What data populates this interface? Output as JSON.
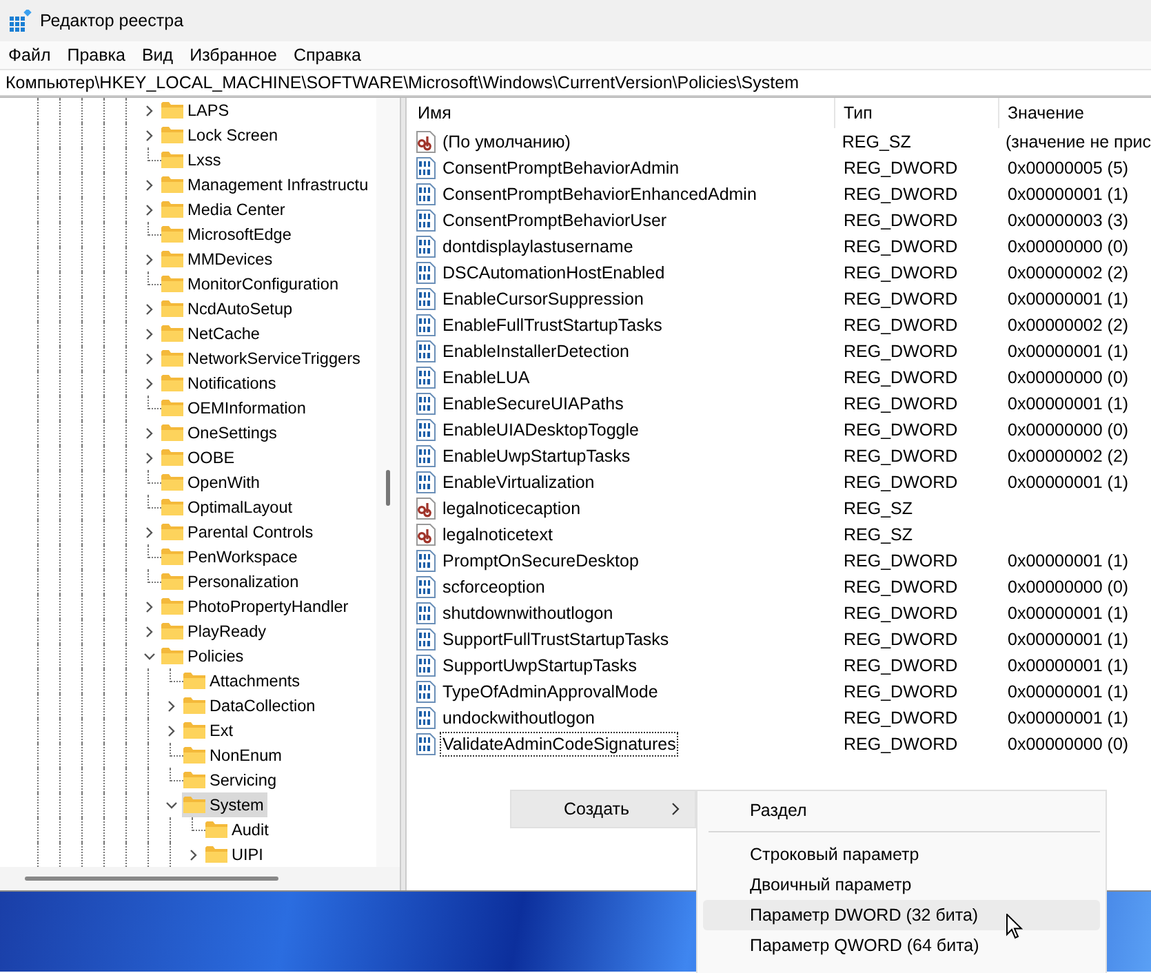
{
  "window": {
    "title": "Редактор реестра"
  },
  "menu_bar": [
    "Файл",
    "Правка",
    "Вид",
    "Избранное",
    "Справка"
  ],
  "address_bar": {
    "value": "Компьютер\\HKEY_LOCAL_MACHINE\\SOFTWARE\\Microsoft\\Windows\\CurrentVersion\\Policies\\System"
  },
  "tree": {
    "items": [
      {
        "label": "LAPS",
        "expandable": true,
        "expanded": false,
        "selected": false
      },
      {
        "label": "Lock Screen",
        "expandable": true,
        "expanded": false,
        "selected": false
      },
      {
        "label": "Lxss",
        "expandable": false,
        "expanded": false,
        "selected": false
      },
      {
        "label": "Management Infrastructu",
        "expandable": true,
        "expanded": false,
        "selected": false
      },
      {
        "label": "Media Center",
        "expandable": true,
        "expanded": false,
        "selected": false
      },
      {
        "label": "MicrosoftEdge",
        "expandable": false,
        "expanded": false,
        "selected": false
      },
      {
        "label": "MMDevices",
        "expandable": true,
        "expanded": false,
        "selected": false
      },
      {
        "label": "MonitorConfiguration",
        "expandable": false,
        "expanded": false,
        "selected": false
      },
      {
        "label": "NcdAutoSetup",
        "expandable": true,
        "expanded": false,
        "selected": false
      },
      {
        "label": "NetCache",
        "expandable": true,
        "expanded": false,
        "selected": false
      },
      {
        "label": "NetworkServiceTriggers",
        "expandable": true,
        "expanded": false,
        "selected": false
      },
      {
        "label": "Notifications",
        "expandable": true,
        "expanded": false,
        "selected": false
      },
      {
        "label": "OEMInformation",
        "expandable": false,
        "expanded": false,
        "selected": false
      },
      {
        "label": "OneSettings",
        "expandable": true,
        "expanded": false,
        "selected": false
      },
      {
        "label": "OOBE",
        "expandable": true,
        "expanded": false,
        "selected": false
      },
      {
        "label": "OpenWith",
        "expandable": false,
        "expanded": false,
        "selected": false
      },
      {
        "label": "OptimalLayout",
        "expandable": false,
        "expanded": false,
        "selected": false
      },
      {
        "label": "Parental Controls",
        "expandable": true,
        "expanded": false,
        "selected": false
      },
      {
        "label": "PenWorkspace",
        "expandable": false,
        "expanded": false,
        "selected": false
      },
      {
        "label": "Personalization",
        "expandable": false,
        "expanded": false,
        "selected": false
      },
      {
        "label": "PhotoPropertyHandler",
        "expandable": true,
        "expanded": false,
        "selected": false
      },
      {
        "label": "PlayReady",
        "expandable": true,
        "expanded": false,
        "selected": false
      },
      {
        "label": "Policies",
        "expandable": true,
        "expanded": true,
        "selected": false,
        "children": [
          {
            "label": "Attachments",
            "expandable": false,
            "expanded": false,
            "selected": false
          },
          {
            "label": "DataCollection",
            "expandable": true,
            "expanded": false,
            "selected": false
          },
          {
            "label": "Ext",
            "expandable": true,
            "expanded": false,
            "selected": false
          },
          {
            "label": "NonEnum",
            "expandable": false,
            "expanded": false,
            "selected": false
          },
          {
            "label": "Servicing",
            "expandable": false,
            "expanded": false,
            "selected": false
          },
          {
            "label": "System",
            "expandable": true,
            "expanded": true,
            "selected": true,
            "children": [
              {
                "label": "Audit",
                "expandable": false,
                "expanded": false,
                "selected": false
              },
              {
                "label": "UIPI",
                "expandable": true,
                "expanded": false,
                "selected": false
              }
            ]
          }
        ]
      }
    ]
  },
  "table": {
    "columns": [
      "Имя",
      "Тип",
      "Значение"
    ],
    "rows": [
      {
        "kind": "string",
        "name": "(По умолчанию)",
        "type": "REG_SZ",
        "value": "(значение не прис",
        "focused": false
      },
      {
        "kind": "dword",
        "name": "ConsentPromptBehaviorAdmin",
        "type": "REG_DWORD",
        "value": "0x00000005 (5)",
        "focused": false
      },
      {
        "kind": "dword",
        "name": "ConsentPromptBehaviorEnhancedAdmin",
        "type": "REG_DWORD",
        "value": "0x00000001 (1)",
        "focused": false
      },
      {
        "kind": "dword",
        "name": "ConsentPromptBehaviorUser",
        "type": "REG_DWORD",
        "value": "0x00000003 (3)",
        "focused": false
      },
      {
        "kind": "dword",
        "name": "dontdisplaylastusername",
        "type": "REG_DWORD",
        "value": "0x00000000 (0)",
        "focused": false
      },
      {
        "kind": "dword",
        "name": "DSCAutomationHostEnabled",
        "type": "REG_DWORD",
        "value": "0x00000002 (2)",
        "focused": false
      },
      {
        "kind": "dword",
        "name": "EnableCursorSuppression",
        "type": "REG_DWORD",
        "value": "0x00000001 (1)",
        "focused": false
      },
      {
        "kind": "dword",
        "name": "EnableFullTrustStartupTasks",
        "type": "REG_DWORD",
        "value": "0x00000002 (2)",
        "focused": false
      },
      {
        "kind": "dword",
        "name": "EnableInstallerDetection",
        "type": "REG_DWORD",
        "value": "0x00000001 (1)",
        "focused": false
      },
      {
        "kind": "dword",
        "name": "EnableLUA",
        "type": "REG_DWORD",
        "value": "0x00000000 (0)",
        "focused": false
      },
      {
        "kind": "dword",
        "name": "EnableSecureUIAPaths",
        "type": "REG_DWORD",
        "value": "0x00000001 (1)",
        "focused": false
      },
      {
        "kind": "dword",
        "name": "EnableUIADesktopToggle",
        "type": "REG_DWORD",
        "value": "0x00000000 (0)",
        "focused": false
      },
      {
        "kind": "dword",
        "name": "EnableUwpStartupTasks",
        "type": "REG_DWORD",
        "value": "0x00000002 (2)",
        "focused": false
      },
      {
        "kind": "dword",
        "name": "EnableVirtualization",
        "type": "REG_DWORD",
        "value": "0x00000001 (1)",
        "focused": false
      },
      {
        "kind": "string",
        "name": "legalnoticecaption",
        "type": "REG_SZ",
        "focused": false
      },
      {
        "kind": "string",
        "name": "legalnoticetext",
        "type": "REG_SZ",
        "focused": false
      },
      {
        "kind": "dword",
        "name": "PromptOnSecureDesktop",
        "type": "REG_DWORD",
        "value": "0x00000001 (1)",
        "focused": false
      },
      {
        "kind": "dword",
        "name": "scforceoption",
        "type": "REG_DWORD",
        "value": "0x00000000 (0)",
        "focused": false
      },
      {
        "kind": "dword",
        "name": "shutdownwithoutlogon",
        "type": "REG_DWORD",
        "value": "0x00000001 (1)",
        "focused": false
      },
      {
        "kind": "dword",
        "name": "SupportFullTrustStartupTasks",
        "type": "REG_DWORD",
        "value": "0x00000001 (1)",
        "focused": false
      },
      {
        "kind": "dword",
        "name": "SupportUwpStartupTasks",
        "type": "REG_DWORD",
        "value": "0x00000001 (1)",
        "focused": false
      },
      {
        "kind": "dword",
        "name": "TypeOfAdminApprovalMode",
        "type": "REG_DWORD",
        "value": "0x00000001 (1)",
        "focused": false
      },
      {
        "kind": "dword",
        "name": "undockwithoutlogon",
        "type": "REG_DWORD",
        "value": "0x00000001 (1)",
        "focused": false
      },
      {
        "kind": "dword",
        "name": "ValidateAdminCodeSignatures",
        "type": "REG_DWORD",
        "value": "0x00000000 (0)",
        "focused": true
      }
    ]
  },
  "context_menu": {
    "items": [
      {
        "label": "Создать",
        "highlighted": true,
        "has_submenu": true
      }
    ]
  },
  "submenu": {
    "items": [
      {
        "kind": "item",
        "label": "Раздел",
        "highlighted": false
      },
      {
        "kind": "separator"
      },
      {
        "kind": "item",
        "label": "Строковый параметр",
        "highlighted": false
      },
      {
        "kind": "item",
        "label": "Двоичный параметр",
        "highlighted": false
      },
      {
        "kind": "item",
        "label": "Параметр DWORD (32 бита)",
        "highlighted": true
      },
      {
        "kind": "item",
        "label": "Параметр QWORD (64 бита)",
        "highlighted": false
      }
    ]
  }
}
